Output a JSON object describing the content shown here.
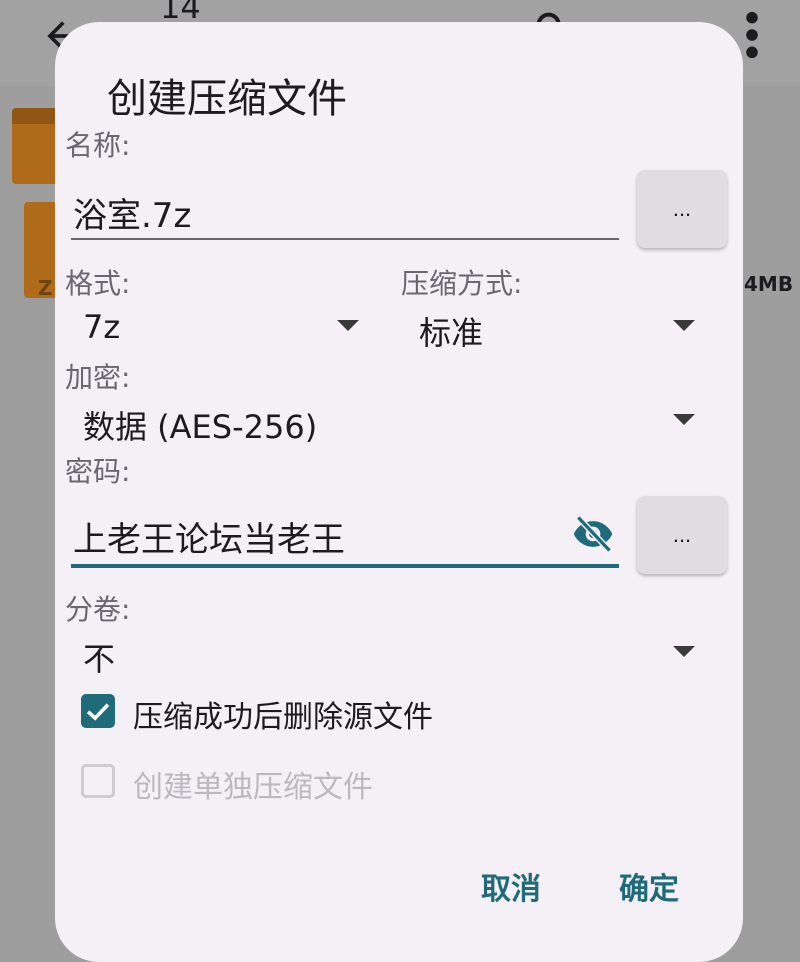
{
  "background": {
    "count": "14",
    "size_text": "4MB",
    "file_letter": "Z"
  },
  "dialog": {
    "title": "创建压缩文件",
    "name_label": "名称:",
    "name_value": "浴室.7z",
    "browse_label": "...",
    "format_label": "格式:",
    "format_value": "7z",
    "method_label": "压缩方式:",
    "method_value": "标准",
    "encryption_label": "加密:",
    "encryption_value": "数据 (AES-256)",
    "password_label": "密码:",
    "password_value": "上老王论坛当老王",
    "password_dots": "...",
    "split_label": "分卷:",
    "split_value": "不",
    "delete_source_label": "压缩成功后删除源文件",
    "delete_source_checked": true,
    "separate_archive_label": "创建单独压缩文件",
    "separate_archive_checked": false,
    "cancel_label": "取消",
    "ok_label": "确定"
  },
  "colors": {
    "accent": "#1f6b7a",
    "dialog_bg": "#f5eff6",
    "scrim": "#9e9e9e"
  }
}
